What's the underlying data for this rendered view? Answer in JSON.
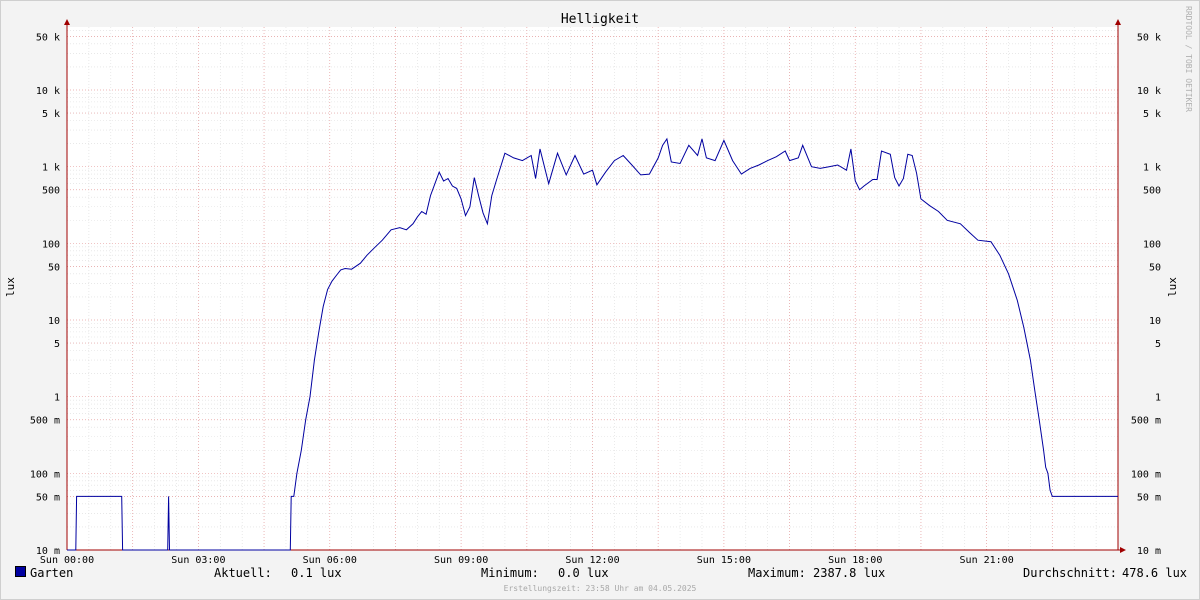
{
  "watermark": "RRDTOOL / TOBI OETIKER",
  "legend": {
    "series_name": "Garten",
    "current_label": "Aktuell:",
    "current_value": "0.1 lux",
    "min_label": "Minimum:",
    "min_value": "0.0 lux",
    "max_label": "Maximum:",
    "max_value": "2387.8 lux",
    "avg_label": "Durchschnitt:",
    "avg_value": "478.6 lux"
  },
  "footer": "Erstellungszeit: 23:58 Uhr am 04.05.2025",
  "colors": {
    "line": "#0000a0",
    "major_grid": "#e8a0a0",
    "minor_grid": "#d8d8d8",
    "background": "#f3f3f3",
    "plot": "#ffffff"
  },
  "chart_data": {
    "type": "line",
    "title": "Helligkeit",
    "ylabel": "lux",
    "yscale": "log",
    "ylim": [
      10,
      70000
    ],
    "xlim": [
      0,
      24
    ],
    "x_unit": "hours since Sun 00:00",
    "grid": true,
    "legend_position": "bottom-left",
    "x_ticks": [
      {
        "x": 0,
        "label": "Sun 00:00"
      },
      {
        "x": 3,
        "label": "Sun 03:00"
      },
      {
        "x": 6,
        "label": "Sun 06:00"
      },
      {
        "x": 9,
        "label": "Sun 09:00"
      },
      {
        "x": 12,
        "label": "Sun 12:00"
      },
      {
        "x": 15,
        "label": "Sun 15:00"
      },
      {
        "x": 18,
        "label": "Sun 18:00"
      },
      {
        "x": 21,
        "label": "Sun 21:00"
      }
    ],
    "y_ticks": [
      {
        "y": 50000,
        "label": "50 k"
      },
      {
        "y": 10000,
        "label": "10 k"
      },
      {
        "y": 5000,
        "label": "5 k"
      },
      {
        "y": 1000,
        "label": "1 k"
      },
      {
        "y": 500,
        "label": "500"
      },
      {
        "y": 100,
        "label": "100"
      },
      {
        "y": 50,
        "label": "50"
      },
      {
        "y": 10,
        "label": "10"
      },
      {
        "y": 5,
        "label": "5"
      },
      {
        "y": 1,
        "label": "1"
      },
      {
        "y": 0.5,
        "label": "500 m"
      },
      {
        "y": 0.1,
        "label": "100 m"
      },
      {
        "y": 0.05,
        "label": "50 m"
      },
      {
        "y": 0.01,
        "label": "10 m"
      }
    ],
    "series": [
      {
        "name": "Garten",
        "points": [
          [
            0.0,
            0.01
          ],
          [
            0.2,
            0.01
          ],
          [
            0.22,
            0.05
          ],
          [
            1.25,
            0.05
          ],
          [
            1.27,
            0.01
          ],
          [
            2.3,
            0.01
          ],
          [
            2.32,
            0.05
          ],
          [
            2.34,
            0.01
          ],
          [
            5.1,
            0.01
          ],
          [
            5.12,
            0.05
          ],
          [
            5.18,
            0.05
          ],
          [
            5.25,
            0.1
          ],
          [
            5.35,
            0.2
          ],
          [
            5.45,
            0.5
          ],
          [
            5.55,
            1
          ],
          [
            5.65,
            3
          ],
          [
            5.75,
            7
          ],
          [
            5.85,
            15
          ],
          [
            5.95,
            25
          ],
          [
            6.05,
            32
          ],
          [
            6.15,
            38
          ],
          [
            6.25,
            45
          ],
          [
            6.35,
            47
          ],
          [
            6.5,
            46
          ],
          [
            6.7,
            55
          ],
          [
            6.85,
            70
          ],
          [
            7.0,
            85
          ],
          [
            7.2,
            110
          ],
          [
            7.4,
            150
          ],
          [
            7.6,
            160
          ],
          [
            7.75,
            150
          ],
          [
            7.9,
            180
          ],
          [
            8.0,
            220
          ],
          [
            8.1,
            260
          ],
          [
            8.2,
            240
          ],
          [
            8.3,
            420
          ],
          [
            8.4,
            600
          ],
          [
            8.5,
            850
          ],
          [
            8.6,
            650
          ],
          [
            8.7,
            700
          ],
          [
            8.8,
            560
          ],
          [
            8.9,
            520
          ],
          [
            9.0,
            380
          ],
          [
            9.1,
            230
          ],
          [
            9.2,
            300
          ],
          [
            9.3,
            720
          ],
          [
            9.4,
            420
          ],
          [
            9.5,
            250
          ],
          [
            9.6,
            180
          ],
          [
            9.7,
            420
          ],
          [
            9.8,
            650
          ],
          [
            10.0,
            1500
          ],
          [
            10.2,
            1300
          ],
          [
            10.4,
            1200
          ],
          [
            10.6,
            1400
          ],
          [
            10.7,
            700
          ],
          [
            10.8,
            1700
          ],
          [
            11.0,
            600
          ],
          [
            11.2,
            1500
          ],
          [
            11.4,
            780
          ],
          [
            11.6,
            1400
          ],
          [
            11.8,
            800
          ],
          [
            12.0,
            900
          ],
          [
            12.1,
            580
          ],
          [
            12.3,
            850
          ],
          [
            12.5,
            1200
          ],
          [
            12.7,
            1400
          ],
          [
            12.9,
            1050
          ],
          [
            13.1,
            780
          ],
          [
            13.3,
            800
          ],
          [
            13.5,
            1300
          ],
          [
            13.6,
            1900
          ],
          [
            13.7,
            2300
          ],
          [
            13.8,
            1150
          ],
          [
            14.0,
            1100
          ],
          [
            14.2,
            1900
          ],
          [
            14.4,
            1400
          ],
          [
            14.5,
            2300
          ],
          [
            14.6,
            1300
          ],
          [
            14.8,
            1200
          ],
          [
            15.0,
            2200
          ],
          [
            15.2,
            1200
          ],
          [
            15.4,
            800
          ],
          [
            15.6,
            950
          ],
          [
            15.8,
            1050
          ],
          [
            16.0,
            1200
          ],
          [
            16.2,
            1350
          ],
          [
            16.4,
            1600
          ],
          [
            16.5,
            1200
          ],
          [
            16.7,
            1300
          ],
          [
            16.8,
            1900
          ],
          [
            17.0,
            1000
          ],
          [
            17.2,
            950
          ],
          [
            17.4,
            1000
          ],
          [
            17.6,
            1050
          ],
          [
            17.8,
            900
          ],
          [
            17.9,
            1700
          ],
          [
            18.0,
            650
          ],
          [
            18.1,
            500
          ],
          [
            18.2,
            560
          ],
          [
            18.4,
            680
          ],
          [
            18.5,
            680
          ],
          [
            18.6,
            1600
          ],
          [
            18.8,
            1450
          ],
          [
            18.9,
            720
          ],
          [
            19.0,
            560
          ],
          [
            19.1,
            700
          ],
          [
            19.2,
            1450
          ],
          [
            19.3,
            1400
          ],
          [
            19.4,
            820
          ],
          [
            19.5,
            380
          ],
          [
            19.7,
            310
          ],
          [
            19.9,
            260
          ],
          [
            20.1,
            200
          ],
          [
            20.4,
            180
          ],
          [
            20.6,
            140
          ],
          [
            20.8,
            110
          ],
          [
            21.1,
            105
          ],
          [
            21.3,
            70
          ],
          [
            21.5,
            40
          ],
          [
            21.7,
            18
          ],
          [
            21.85,
            8
          ],
          [
            22.0,
            3
          ],
          [
            22.1,
            1.2
          ],
          [
            22.2,
            0.5
          ],
          [
            22.3,
            0.2
          ],
          [
            22.35,
            0.12
          ],
          [
            22.4,
            0.1
          ],
          [
            22.45,
            0.06
          ],
          [
            22.5,
            0.05
          ],
          [
            24.0,
            0.05
          ]
        ]
      }
    ]
  }
}
